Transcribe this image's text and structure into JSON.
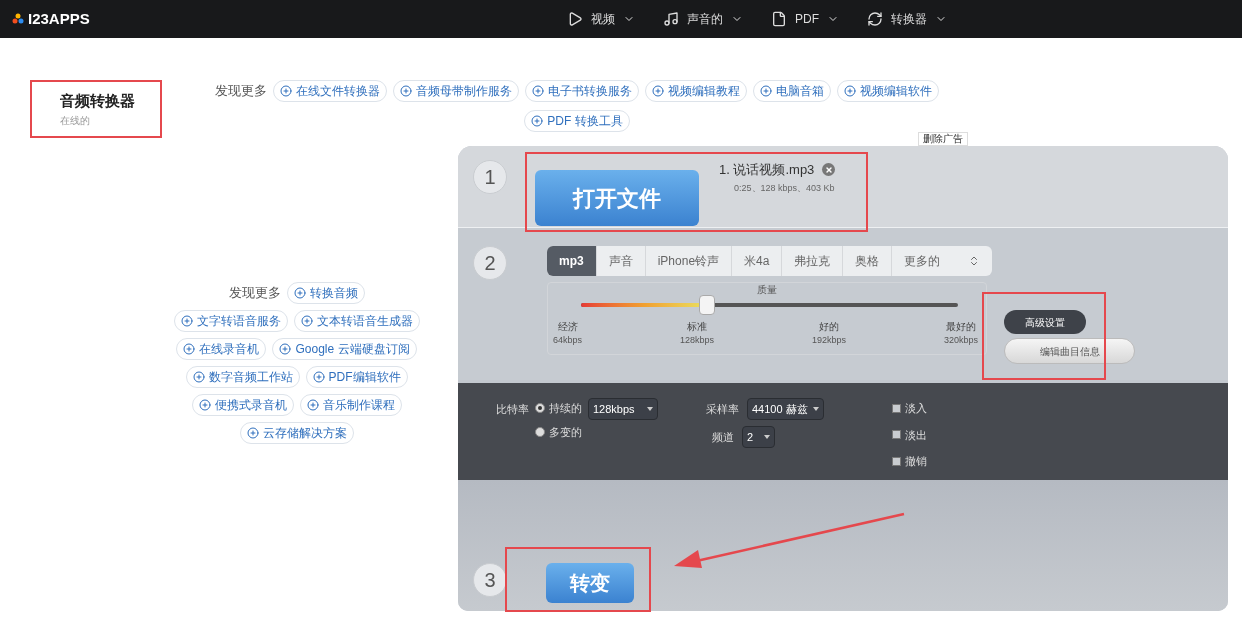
{
  "header": {
    "logo": "I23APPS",
    "nav": [
      {
        "label": "视频"
      },
      {
        "label": "声音的"
      },
      {
        "label": "PDF"
      },
      {
        "label": "转换器"
      }
    ]
  },
  "title": {
    "heading": "音频转换器",
    "subtitle": "在线的"
  },
  "discover_top": {
    "label": "发现更多",
    "links": [
      "在线文件转换器",
      "音频母带制作服务",
      "电子书转换服务",
      "视频编辑教程",
      "电脑音箱",
      "视频编辑软件",
      "PDF 转换工具"
    ]
  },
  "discover_side": {
    "label": "发现更多",
    "links": [
      "转换音频",
      "文字转语音服务",
      "文本转语音生成器",
      "在线录音机",
      "Google 云端硬盘订阅",
      "数字音频工作站",
      "PDF编辑软件",
      "便携式录音机",
      "音乐制作课程",
      "云存储解决方案"
    ]
  },
  "remove_ads": "删除广告",
  "step1": {
    "number": "1",
    "button": "打开文件",
    "file": {
      "name": "1. 说话视频.mp3",
      "meta": "0:25、128 kbps、403 Kb"
    }
  },
  "step2": {
    "number": "2",
    "formats": [
      {
        "label": "mp3",
        "selected": true
      },
      {
        "label": "声音",
        "selected": false
      },
      {
        "label": "iPhone铃声",
        "selected": false
      },
      {
        "label": "米4a",
        "selected": false
      },
      {
        "label": "弗拉克",
        "selected": false
      },
      {
        "label": "奥格",
        "selected": false
      },
      {
        "label": "更多的",
        "selected": false
      }
    ],
    "quality": {
      "title": "质量",
      "level": 0.333,
      "stops": [
        {
          "label": "经济",
          "rate": "64kbps"
        },
        {
          "label": "标准",
          "rate": "128kbps"
        },
        {
          "label": "好的",
          "rate": "192kbps"
        },
        {
          "label": "最好的",
          "rate": "320kbps"
        }
      ]
    },
    "advanced_button": {
      "label": "高级设置",
      "active": true
    },
    "edit_button": "编辑曲目信息"
  },
  "settings": {
    "bitrate_label": "比特率",
    "bitrate_modes": [
      {
        "label": "持续的",
        "selected": true
      },
      {
        "label": "多变的",
        "selected": false
      }
    ],
    "bitrate_value": "128kbps",
    "sample_rate_label": "采样率",
    "sample_rate_value": "44100 赫兹",
    "channels_label": "频道",
    "channels_value": "2",
    "effects": [
      {
        "label": "淡入",
        "checked": false
      },
      {
        "label": "淡出",
        "checked": false
      },
      {
        "label": "撤销",
        "checked": false
      }
    ]
  },
  "step3": {
    "number": "3",
    "button": "转变"
  }
}
